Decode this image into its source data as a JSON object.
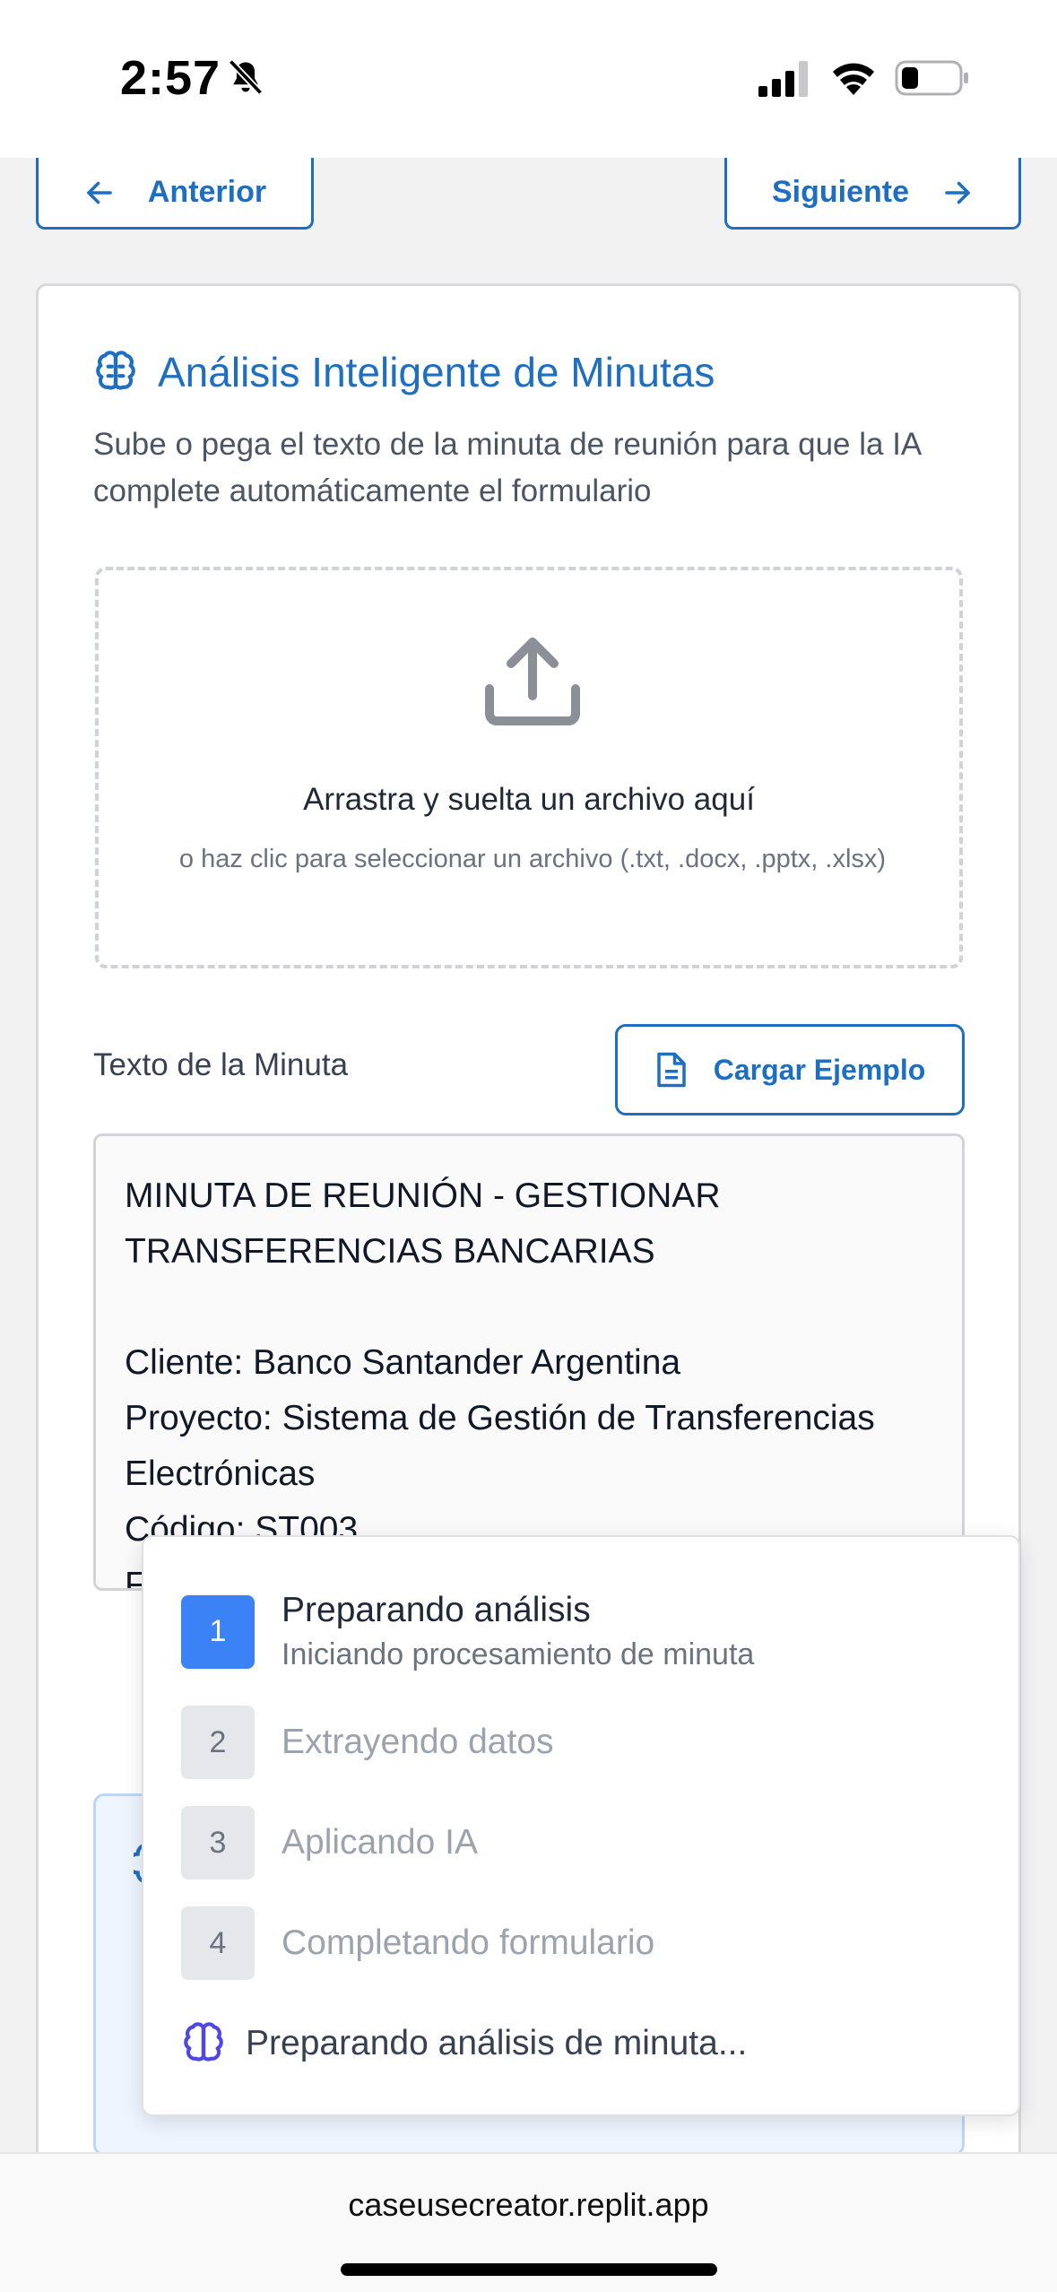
{
  "status_bar": {
    "time": "2:57"
  },
  "nav": {
    "prev_label": "Anterior",
    "next_label": "Siguiente"
  },
  "card": {
    "title": "Análisis Inteligente de Minutas",
    "description": "Sube o pega el texto de la minuta de reunión para que la IA complete automáticamente el formulario"
  },
  "dropzone": {
    "main_text": "Arrastra y suelta un archivo aquí",
    "sub_text": "o haz clic para seleccionar un archivo (.txt, .docx, .pptx, .xlsx)"
  },
  "minuta": {
    "label": "Texto de la Minuta",
    "load_example_label": "Cargar Ejemplo",
    "text": "MINUTA DE REUNIÓN - GESTIONAR TRANSFERENCIAS BANCARIAS\n\nCliente: Banco Santander Argentina\nProyecto: Sistema de Gestión de Transferencias Electrónicas\nCódigo: ST003\nF"
  },
  "progress": {
    "steps": [
      {
        "number": "1",
        "title": "Preparando análisis",
        "subtitle": "Iniciando procesamiento de minuta",
        "state": "active"
      },
      {
        "number": "2",
        "title": "Extrayendo datos",
        "state": "pending"
      },
      {
        "number": "3",
        "title": "Aplicando IA",
        "state": "pending"
      },
      {
        "number": "4",
        "title": "Completando formulario",
        "state": "pending"
      }
    ],
    "footer_text": "Preparando análisis de minuta..."
  },
  "browser": {
    "url": "caseusecreator.replit.app"
  },
  "colors": {
    "accent": "#1e6fc2",
    "step_active": "#3b82f6",
    "footer_icon": "#4f46e5"
  }
}
